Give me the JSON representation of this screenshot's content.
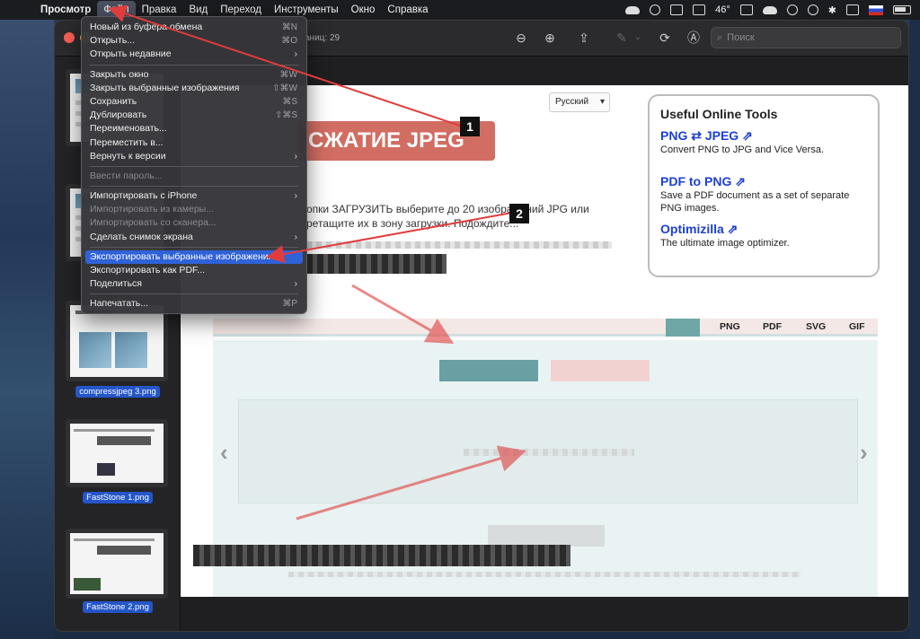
{
  "menubar": {
    "app": "Просмотр",
    "items": [
      "Файл",
      "Правка",
      "Вид",
      "Переход",
      "Инструменты",
      "Окно",
      "Справка"
    ],
    "active_index": 0,
    "temperature": "46°"
  },
  "window": {
    "page_count": "аниц: 29",
    "search_placeholder": "Поиск"
  },
  "file_menu": {
    "items": [
      {
        "label": "Новый из буфера обмена",
        "shortcut": "⌘N"
      },
      {
        "label": "Открыть...",
        "shortcut": "⌘O"
      },
      {
        "label": "Открыть недавние",
        "submenu": true
      },
      {
        "separator": true
      },
      {
        "label": "Закрыть окно",
        "shortcut": "⌘W"
      },
      {
        "label": "Закрыть выбранные изображения",
        "shortcut": "⇧⌘W"
      },
      {
        "label": "Сохранить",
        "shortcut": "⌘S"
      },
      {
        "label": "Дублировать",
        "shortcut": "⇧⌘S"
      },
      {
        "label": "Переименовать..."
      },
      {
        "label": "Переместить в..."
      },
      {
        "label": "Вернуть к версии",
        "submenu": true
      },
      {
        "separator": true
      },
      {
        "label": "Ввести пароль...",
        "disabled": true
      },
      {
        "separator": true
      },
      {
        "label": "Импортировать с iPhone",
        "submenu": true
      },
      {
        "label": "Импортировать из камеры...",
        "disabled": true
      },
      {
        "label": "Импортировать со сканера...",
        "disabled": true
      },
      {
        "label": "Сделать снимок экрана",
        "submenu": true
      },
      {
        "separator": true
      },
      {
        "label": "Экспортировать выбранные изображения...",
        "highlighted": true
      },
      {
        "label": "Экспортировать как PDF..."
      },
      {
        "label": "Поделиться",
        "submenu": true
      },
      {
        "separator": true
      },
      {
        "label": "Напечатать...",
        "shortcut": "⌘P"
      }
    ]
  },
  "sidebar": {
    "thumbnails": [
      {
        "label": ""
      },
      {
        "label": ""
      },
      {
        "label": "compressjpeg 3.png"
      },
      {
        "label": "FastStone 1.png"
      },
      {
        "label": "FastStone 2.png"
      }
    ]
  },
  "page": {
    "language": "Русский",
    "title": "СЖАТИЕ JPEG",
    "intro_line1": "опки ЗАГРУЗИТЬ выберите до 20 изображений JPG или",
    "intro_line2": "ретащите их в зону загрузки. Подождите...",
    "tools": {
      "heading": "Useful Online Tools",
      "items": [
        {
          "title": "PNG ⇄ JPEG ⇗",
          "desc": "Convert PNG to JPG and Vice Versa."
        },
        {
          "title": "PDF to PNG ⇗",
          "desc": "Save a PDF document as a set of separate PNG images."
        },
        {
          "title": "Optimizilla ⇗",
          "desc": "The ultimate image optimizer."
        }
      ]
    },
    "tabs": [
      "PNG",
      "PDF",
      "SVG",
      "GIF"
    ]
  },
  "annotations": {
    "badge1": "1",
    "badge2": "2",
    "arrow_color": "#e03c3c"
  }
}
